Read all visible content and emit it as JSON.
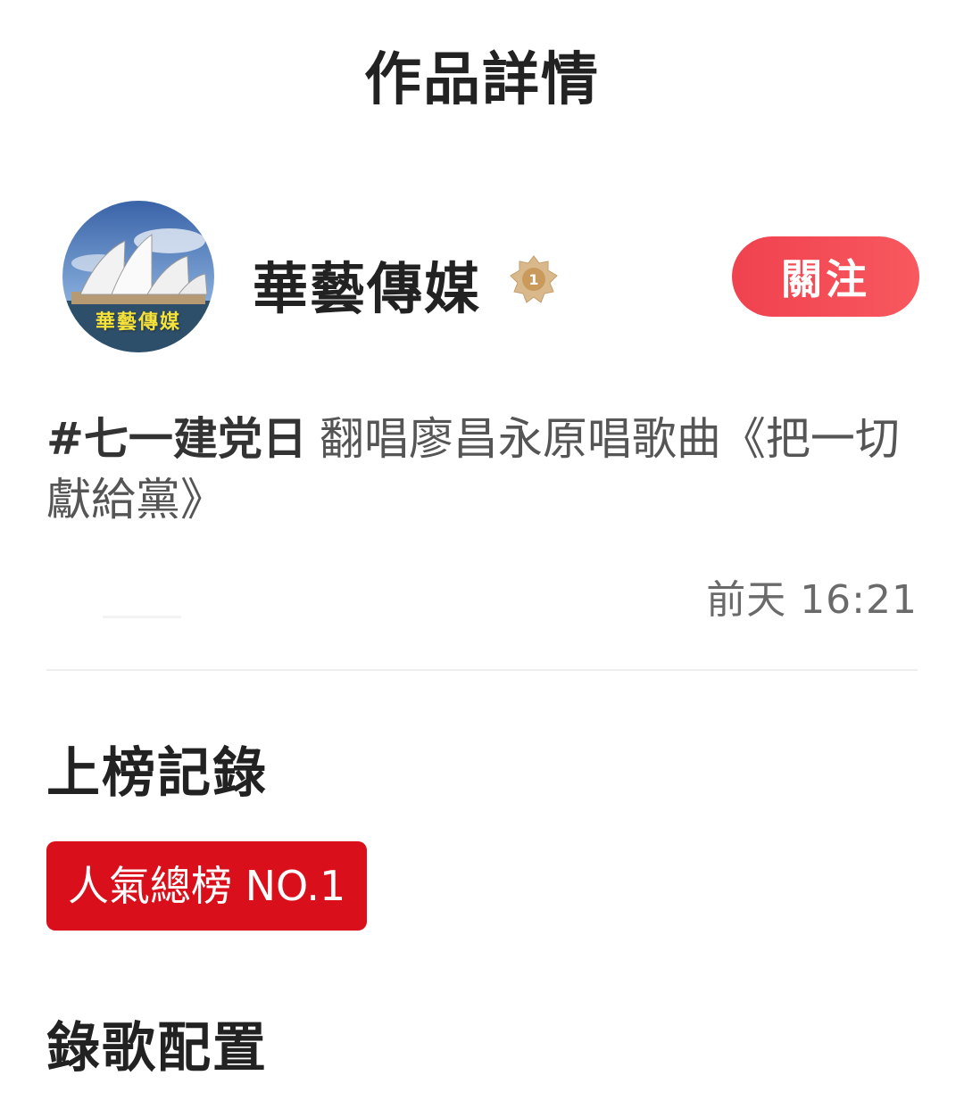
{
  "header": {
    "title": "作品詳情"
  },
  "author": {
    "avatar_caption": "華藝傳媒",
    "name": "華藝傳媒",
    "rank_badge": "1",
    "follow_label": "關注"
  },
  "post": {
    "hashtag": "#七一建党日",
    "description": "翻唱廖昌永原唱歌曲《把一切獻給黨》",
    "timestamp": "前天 16:21"
  },
  "charts_section": {
    "title": "上榜記錄",
    "badge": "人氣總榜 NO.1",
    "badge_color": "#d9101b"
  },
  "recording_section": {
    "title": "錄歌配置"
  },
  "colors": {
    "follow_button": "#f24a55",
    "text_primary": "#222222"
  }
}
